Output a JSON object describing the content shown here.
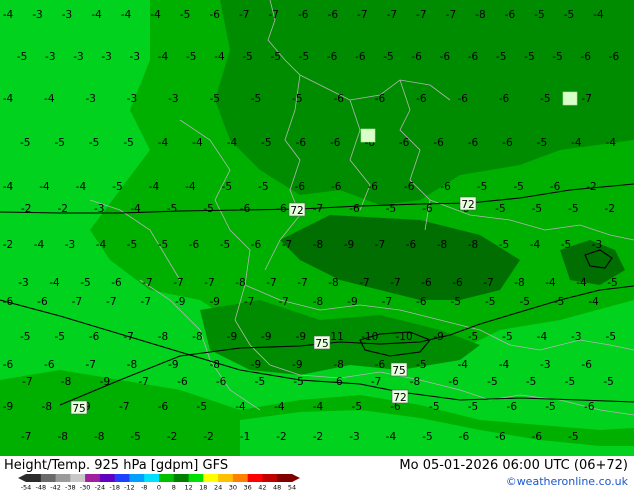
{
  "map": {
    "title": "Height/Temp. 925 hPa [gdpm] GFS",
    "valid_time": "Mo 05-01-2026 06:00 UTC (06+72)",
    "credit": "©weatheronline.co.uk",
    "colors": {
      "bright_green": "#00d21e",
      "mid_green": "#00b000",
      "dark_green": "#008c00",
      "darker_green": "#006e00",
      "border": "#b4b4b4",
      "contour": "#000000"
    },
    "height_labels": [
      "72",
      "72",
      "75",
      "75",
      "72",
      "75"
    ],
    "temperature_labels": [
      "-4",
      "-3",
      "-3",
      "-4",
      "-4",
      "-4",
      "-5",
      "-6",
      "-7",
      "-7",
      "-6",
      "-6",
      "-7",
      "-7",
      "-7",
      "-7",
      "-8",
      "-6",
      "-5",
      "-5",
      "-4",
      "-5",
      "-3",
      "-3",
      "-3",
      "-3",
      "-4",
      "-5",
      "-4",
      "-5",
      "-5",
      "-5",
      "-6",
      "-6",
      "-5",
      "-6",
      "-6",
      "-6",
      "-5",
      "-5",
      "-5",
      "-6",
      "-6",
      "-4",
      "-4",
      "-3",
      "-3",
      "-3",
      "-5",
      "-5",
      "-5",
      "-6",
      "-6",
      "-6",
      "-6",
      "-6",
      "-5",
      "-7",
      "-5",
      "-5",
      "-5",
      "-5",
      "-4",
      "-4",
      "-4",
      "-5",
      "-6",
      "-6",
      "-6",
      "-6",
      "-6",
      "-6",
      "-6",
      "-5",
      "-4",
      "-4",
      "-4",
      "-4",
      "-4",
      "-5",
      "-4",
      "-4",
      "-5",
      "-5",
      "-6",
      "-6",
      "-6",
      "-6",
      "-6",
      "-5",
      "-5",
      "-6",
      "-2",
      "-2",
      "-2",
      "-3",
      "-4",
      "-5",
      "-5",
      "-6",
      "-6",
      "-7",
      "-6",
      "-5",
      "-6",
      "-6",
      "-5",
      "-5",
      "-5",
      "-2",
      "-2",
      "-4",
      "-3",
      "-4",
      "-5",
      "-5",
      "-6",
      "-5",
      "-6",
      "-7",
      "-8",
      "-9",
      "-7",
      "-6",
      "-8",
      "-8",
      "-5",
      "-4",
      "-5",
      "-3",
      "-3",
      "-4",
      "-5",
      "-6",
      "-7",
      "-7",
      "-7",
      "-8",
      "-7",
      "-7",
      "-8",
      "-7",
      "-7",
      "-6",
      "-6",
      "-7",
      "-8",
      "-4",
      "-4",
      "-5",
      "-6",
      "-6",
      "-7",
      "-7",
      "-7",
      "-9",
      "-9",
      "-7",
      "-7",
      "-8",
      "-9",
      "-7",
      "-6",
      "-5",
      "-5",
      "-5",
      "-5",
      "-4",
      "-5",
      "-5",
      "-6",
      "-7",
      "-8",
      "-8",
      "-9",
      "-9",
      "-9",
      "-11",
      "-10",
      "-10",
      "-9",
      "-5",
      "-5",
      "-4",
      "-3",
      "-5",
      "-6",
      "-6",
      "-7",
      "-8",
      "-9",
      "-8",
      "-9",
      "-9",
      "-8",
      "-6",
      "-5",
      "-4",
      "-4",
      "-3",
      "-6",
      "-7",
      "-8",
      "-9",
      "-7",
      "-6",
      "-6",
      "-5",
      "-5",
      "-6",
      "-7",
      "-8",
      "-6",
      "-5",
      "-5",
      "-5",
      "-5",
      "-9",
      "-8",
      "-9",
      "-7",
      "-6",
      "-5",
      "-4",
      "-4",
      "-4",
      "-5",
      "-6",
      "-5",
      "-5",
      "-6",
      "-5",
      "-6",
      "-7",
      "-8",
      "-8",
      "-5",
      "-2",
      "-2",
      "-1",
      "-2",
      "-2",
      "-3",
      "-4",
      "-5",
      "-6",
      "-6",
      "-6",
      "-5"
    ]
  },
  "colorbar": {
    "tick_labels": [
      "-54",
      "-48",
      "-42",
      "-38",
      "-30",
      "-24",
      "-18",
      "-12",
      "-8",
      "0",
      "8",
      "12",
      "18",
      "24",
      "30",
      "36",
      "42",
      "48",
      "54"
    ],
    "colors": [
      "#2b2b2b",
      "#6a6a6a",
      "#9a9a9a",
      "#c8c8c8",
      "#a020a0",
      "#6000c0",
      "#2040ff",
      "#00a0ff",
      "#00e0ff",
      "#00c000",
      "#008000",
      "#00e000",
      "#ffff00",
      "#ffc000",
      "#ff8000",
      "#ff0000",
      "#c00000",
      "#800000"
    ]
  }
}
